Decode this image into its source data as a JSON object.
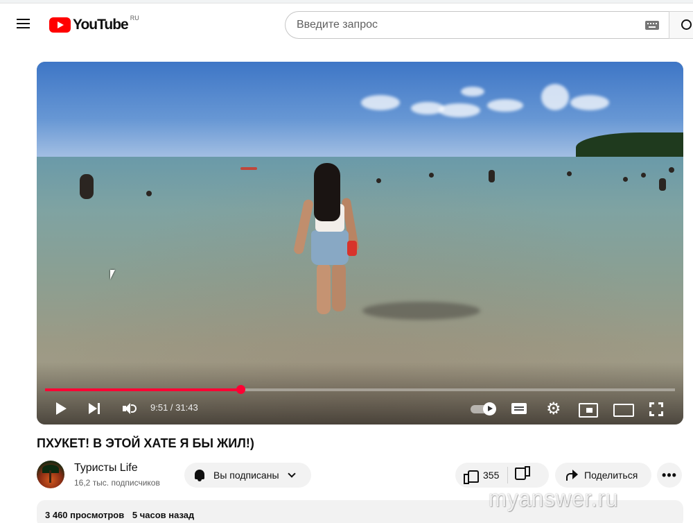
{
  "masthead": {
    "logo_text": "YouTube",
    "region": "RU",
    "search_placeholder": "Введите запрос"
  },
  "player": {
    "time": "9:51 / 31:43",
    "progress_fraction": 0.31,
    "progress_color": "#ff0033"
  },
  "video": {
    "title": "ПХУКЕТ! В ЭТОЙ ХАТЕ Я БЫ ЖИЛ!)"
  },
  "channel": {
    "name": "Туристы Life",
    "subscribers": "16,2 тыс. подписчиков"
  },
  "actions": {
    "subscribed_label": "Вы подписаны",
    "like_count": "355",
    "share_label": "Поделиться",
    "more_label": "•••"
  },
  "description": {
    "views": "3 460 просмотров",
    "published": "5 часов назад"
  },
  "watermark": "myanswer.ru",
  "icons": [
    "menu-icon",
    "youtube-logo",
    "keyboard-icon",
    "search-icon",
    "play-icon",
    "next-icon",
    "volume-icon",
    "autoplay-toggle",
    "subtitles-icon",
    "settings-icon",
    "miniplayer-icon",
    "theater-icon",
    "fullscreen-icon",
    "bell-icon",
    "chevron-down-icon",
    "like-icon",
    "dislike-icon",
    "share-icon",
    "more-icon"
  ]
}
